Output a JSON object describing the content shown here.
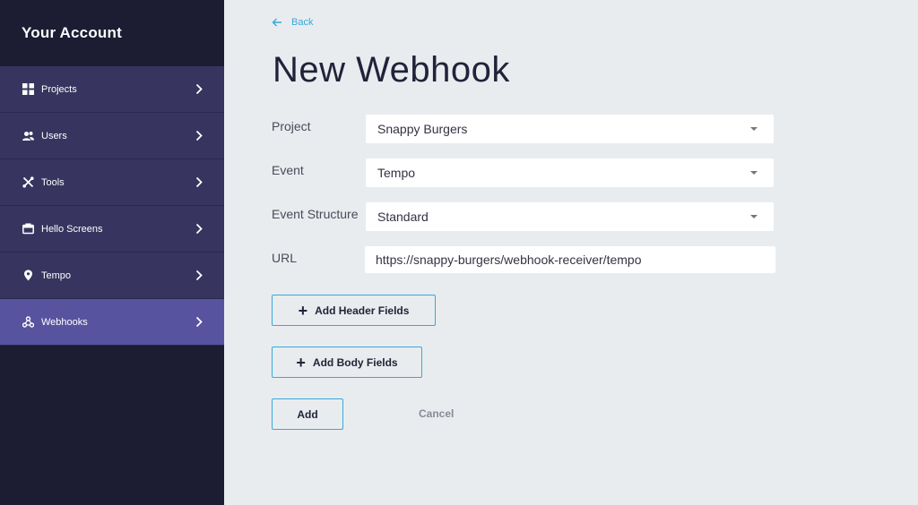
{
  "sidebar": {
    "title": "Your Account",
    "items": [
      {
        "label": "Projects",
        "icon": "grid-icon"
      },
      {
        "label": "Users",
        "icon": "users-icon"
      },
      {
        "label": "Tools",
        "icon": "tools-icon"
      },
      {
        "label": "Hello Screens",
        "icon": "screen-icon"
      },
      {
        "label": "Tempo",
        "icon": "location-pin-icon"
      },
      {
        "label": "Webhooks",
        "icon": "webhook-icon",
        "active": true
      }
    ]
  },
  "main": {
    "back_label": "Back",
    "title": "New Webhook",
    "form": {
      "project": {
        "label": "Project",
        "value": "Snappy Burgers"
      },
      "event": {
        "label": "Event",
        "value": "Tempo"
      },
      "event_structure": {
        "label": "Event Structure",
        "value": "Standard"
      },
      "url": {
        "label": "URL",
        "value": "https://snappy-burgers/webhook-receiver/tempo"
      }
    },
    "add_header_fields_label": "Add Header Fields",
    "add_body_fields_label": "Add Body Fields",
    "add_label": "Add",
    "cancel_label": "Cancel"
  },
  "colors": {
    "sidebar_bg": "#1c1c33",
    "nav_item_bg": "#37345f",
    "nav_active_bg": "#57539f",
    "accent": "#36a9d9",
    "page_bg": "#e9ecef"
  }
}
